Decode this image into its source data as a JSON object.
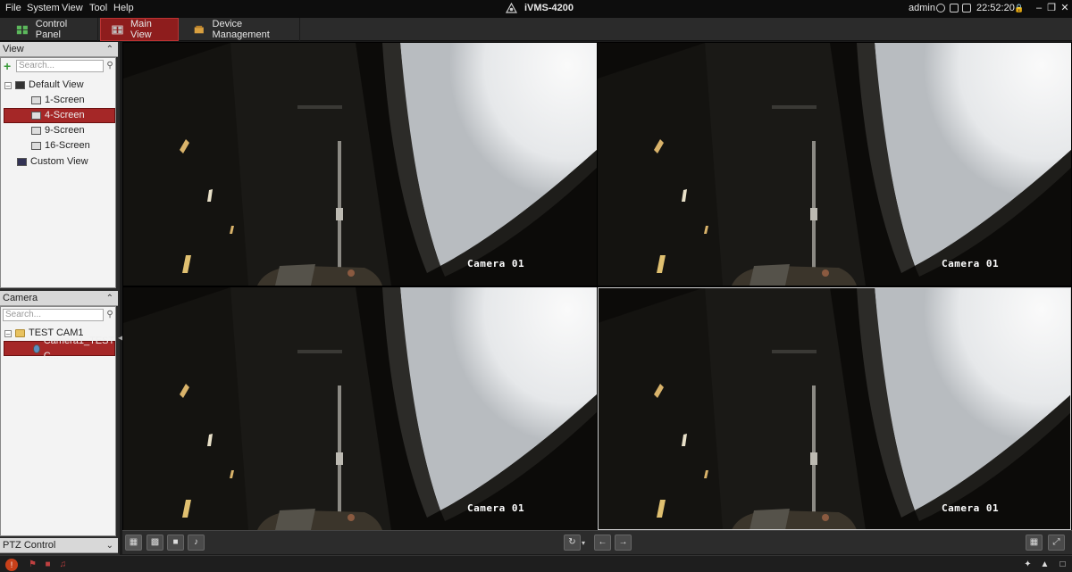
{
  "menubar": {
    "items": [
      "File",
      "System",
      "View",
      "Tool",
      "Help"
    ],
    "app_title": "iVMS-4200",
    "user": "admin",
    "clock": "22:52:20"
  },
  "tabs": [
    {
      "label": "Control Panel",
      "icon": "control-panel-icon",
      "active": false
    },
    {
      "label": "Main View",
      "icon": "main-view-icon",
      "active": true
    },
    {
      "label": "Device Management",
      "icon": "device-management-icon",
      "active": false
    }
  ],
  "view_panel": {
    "title": "View",
    "search_placeholder": "Search...",
    "tree": [
      {
        "label": "Default View",
        "level": 0,
        "expanded": true
      },
      {
        "label": "1-Screen",
        "level": 1
      },
      {
        "label": "4-Screen",
        "level": 1,
        "selected": true
      },
      {
        "label": "9-Screen",
        "level": 1
      },
      {
        "label": "16-Screen",
        "level": 1
      },
      {
        "label": "Custom View",
        "level": 0
      }
    ]
  },
  "camera_panel": {
    "title": "Camera",
    "search_placeholder": "Search...",
    "tree": [
      {
        "label": "TEST CAM1",
        "level": 0,
        "expanded": true
      },
      {
        "label": "Camera1_TEST C...",
        "level": 1,
        "selected": true
      }
    ]
  },
  "ptz_panel": {
    "title": "PTZ Control"
  },
  "video_cells": [
    {
      "label": "Camera 01",
      "selected": false
    },
    {
      "label": "Camera 01",
      "selected": false
    },
    {
      "label": "Camera 01",
      "selected": false
    },
    {
      "label": "Camera 01",
      "selected": true
    }
  ],
  "colors": {
    "accent": "#8e1d1d",
    "selection": "#a52727",
    "background": "#1a1a1a"
  }
}
